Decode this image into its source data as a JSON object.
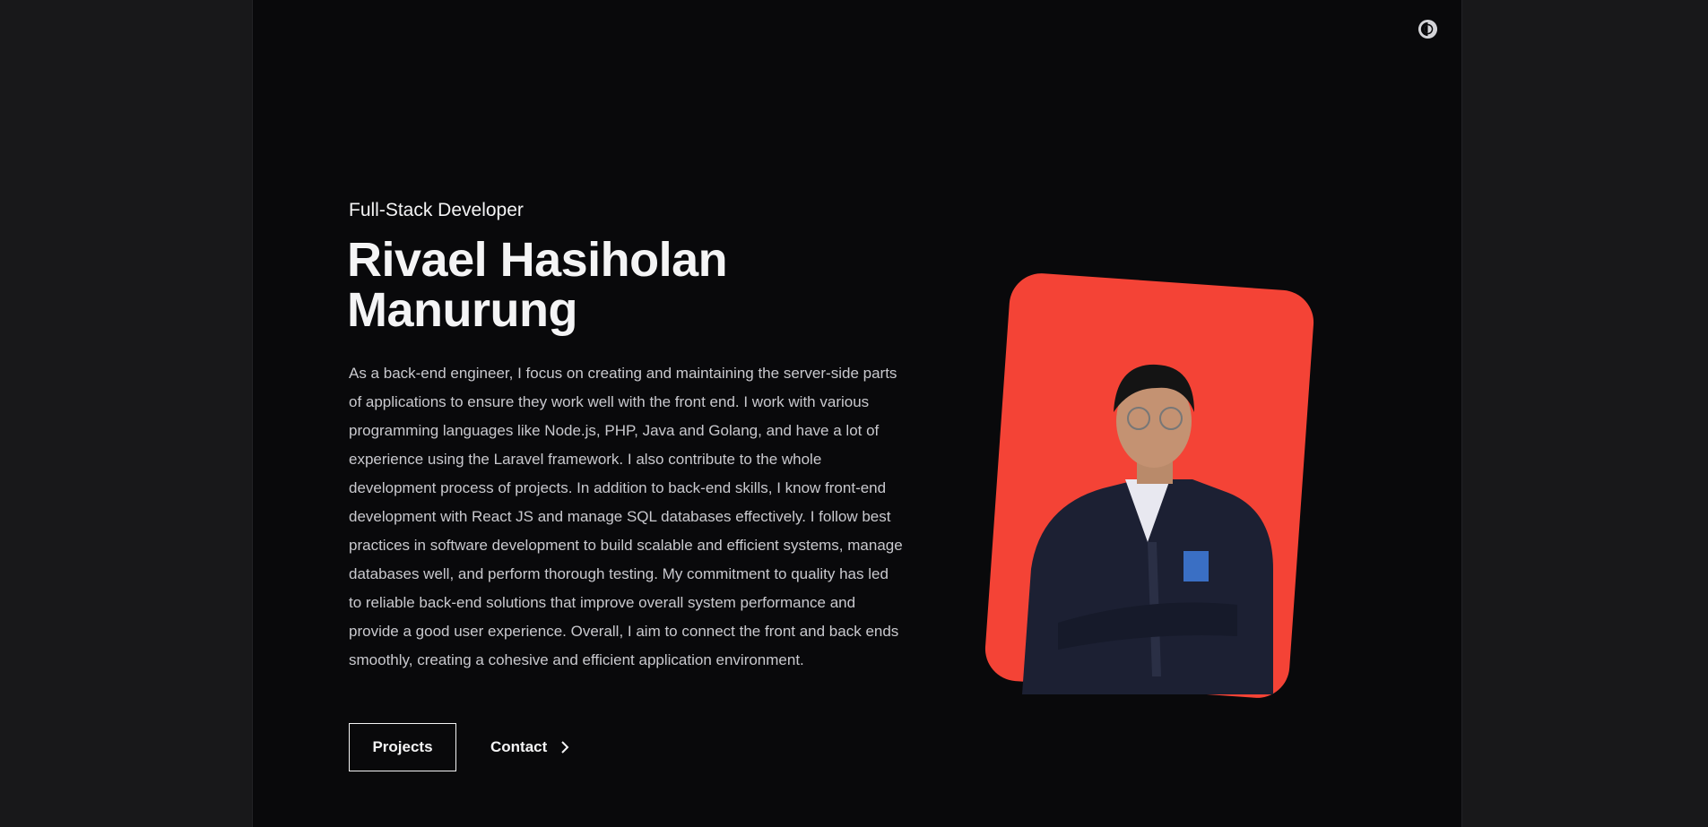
{
  "header": {
    "theme_toggle_icon": "contrast-icon"
  },
  "hero": {
    "subtitle": "Full-Stack Developer",
    "name": "Rivael Hasiholan Manurung",
    "description": "As a back-end engineer, I focus on creating and maintaining the server-side parts of applications to ensure they work well with the front end. I work with various programming languages like Node.js, PHP, Java and Golang, and have a lot of experience using the Laravel framework. I also contribute to the whole development process of projects. In addition to back-end skills, I know front-end development with React JS and manage SQL databases effectively. I follow best practices in software development to build scalable and efficient systems, manage databases well, and perform thorough testing. My commitment to quality has led to reliable back-end solutions that improve overall system performance and provide a good user experience. Overall, I aim to connect the front and back ends smoothly, creating a cohesive and efficient application environment.",
    "projects_label": "Projects",
    "contact_label": "Contact",
    "contact_icon": "chevron-right-icon",
    "photo_bg_color": "#f44336"
  }
}
